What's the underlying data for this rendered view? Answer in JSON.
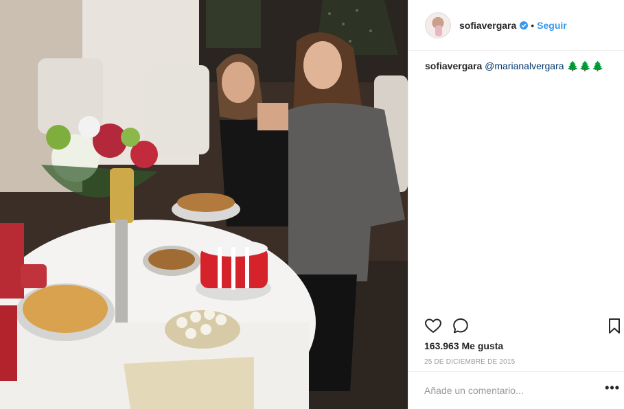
{
  "post": {
    "username": "sofiavergara",
    "follow_label": "Seguir",
    "separator": "•",
    "caption_user": "sofiavergara",
    "caption_mention": "@marianalvergara",
    "caption_trees": "🌲🌲🌲",
    "likes": "163.963 Me gusta",
    "date": "25 DE DICIEMBRE DE 2015",
    "comment_placeholder": "Añade un comentario...",
    "more_label": "•••"
  },
  "colors": {
    "link": "#3897f0",
    "mention": "#003569",
    "verified": "#3897f0"
  },
  "icons": {
    "like": "heart-icon",
    "comment": "comment-icon",
    "save": "bookmark-icon",
    "verified": "verified-badge-icon"
  }
}
